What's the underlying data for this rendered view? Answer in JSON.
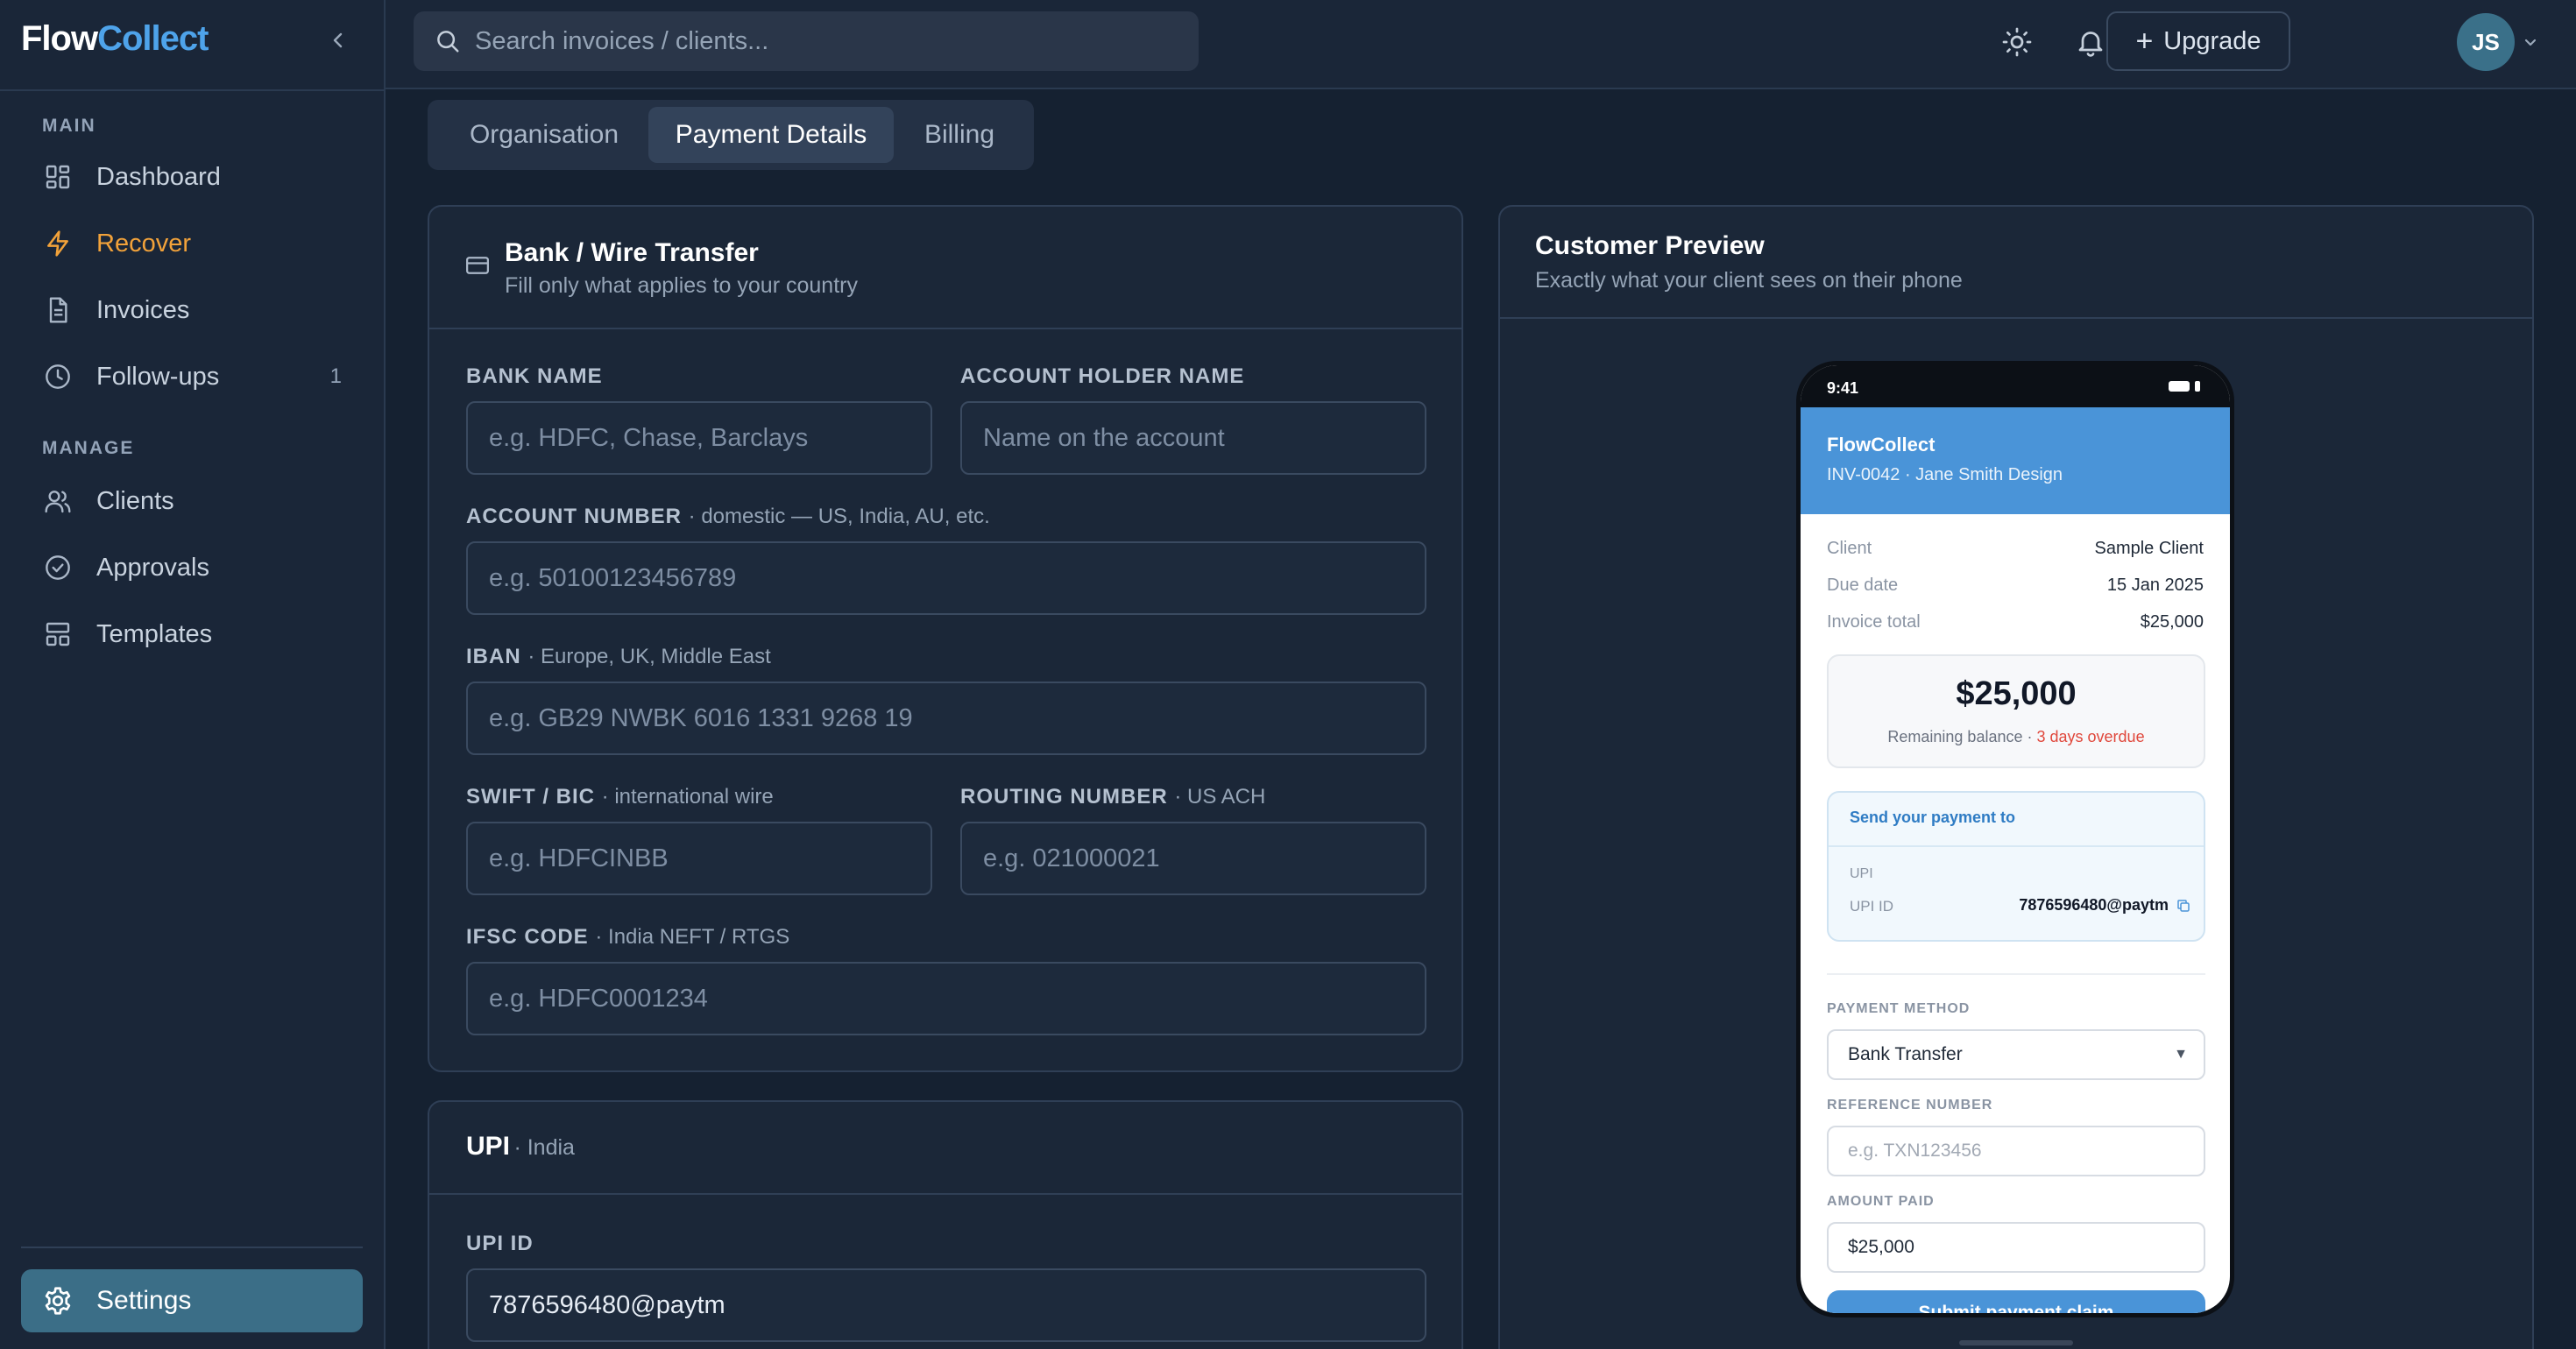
{
  "app": {
    "logo_part1": "Flow",
    "logo_part2": "Collect"
  },
  "sidebar": {
    "sections": [
      {
        "label": "MAIN"
      },
      {
        "label": "MANAGE"
      }
    ],
    "items": [
      {
        "label": "Dashboard",
        "icon": "dashboard-icon"
      },
      {
        "label": "Recover",
        "icon": "lightning-icon",
        "active": true
      },
      {
        "label": "Invoices",
        "icon": "document-icon"
      },
      {
        "label": "Follow-ups",
        "icon": "clock-icon",
        "count": "1"
      },
      {
        "label": "Clients",
        "icon": "users-icon"
      },
      {
        "label": "Approvals",
        "icon": "check-circle-icon"
      },
      {
        "label": "Templates",
        "icon": "templates-icon"
      }
    ],
    "settings_label": "Settings"
  },
  "topbar": {
    "search_placeholder": "Search invoices / clients...",
    "upgrade_label": "Upgrade",
    "avatar_initials": "JS"
  },
  "tabs": [
    {
      "label": "Organisation"
    },
    {
      "label": "Payment Details",
      "active": true
    },
    {
      "label": "Billing"
    }
  ],
  "bank_card": {
    "title": "Bank / Wire Transfer",
    "subtitle": "Fill only what applies to your country",
    "fields": {
      "bank_name": {
        "label": "BANK NAME",
        "placeholder": "e.g. HDFC, Chase, Barclays"
      },
      "account_holder": {
        "label": "ACCOUNT HOLDER NAME",
        "placeholder": "Name on the account"
      },
      "account_number": {
        "label": "ACCOUNT NUMBER",
        "hint": "· domestic — US, India, AU, etc.",
        "placeholder": "e.g. 50100123456789"
      },
      "iban": {
        "label": "IBAN",
        "hint": "· Europe, UK, Middle East",
        "placeholder": "e.g. GB29 NWBK 6016 1331 9268 19"
      },
      "swift": {
        "label": "SWIFT / BIC",
        "hint": "· international wire",
        "placeholder": "e.g. HDFCINBB"
      },
      "routing": {
        "label": "ROUTING NUMBER",
        "hint": "· US ACH",
        "placeholder": "e.g. 021000021"
      },
      "ifsc": {
        "label": "IFSC CODE",
        "hint": "· India NEFT / RTGS",
        "placeholder": "e.g. HDFC0001234"
      }
    }
  },
  "upi_card": {
    "title": "UPI",
    "subtitle": "· India",
    "upi_id_label": "UPI ID",
    "upi_id_value": "7876596480@paytm"
  },
  "preview": {
    "title": "Customer Preview",
    "subtitle": "Exactly what your client sees on their phone",
    "phone": {
      "time": "9:41",
      "brand": "FlowCollect",
      "invoice_line": "INV-0042 · Jane Smith Design",
      "client_label": "Client",
      "client_value": "Sample Client",
      "due_label": "Due date",
      "due_value": "15 Jan 2025",
      "total_label": "Invoice total",
      "total_value": "$25,000",
      "balance_amount": "$25,000",
      "balance_text": "Remaining balance · ",
      "overdue_text": "3 days overdue",
      "send_to": "Send your payment to",
      "upi_heading": "UPI",
      "upi_id_label": "UPI ID",
      "upi_id_value": "7876596480@paytm",
      "payment_method_label": "PAYMENT METHOD",
      "payment_method_value": "Bank Transfer",
      "reference_label": "REFERENCE NUMBER",
      "reference_placeholder": "e.g. TXN123456",
      "amount_label": "AMOUNT PAID",
      "amount_value": "$25,000",
      "submit_label": "Submit payment claim"
    }
  },
  "colors": {
    "accent": "#4ea3ea",
    "active_nav": "#f2a23a",
    "overdue": "#e0483c",
    "settings_bg": "#3b6e87"
  }
}
